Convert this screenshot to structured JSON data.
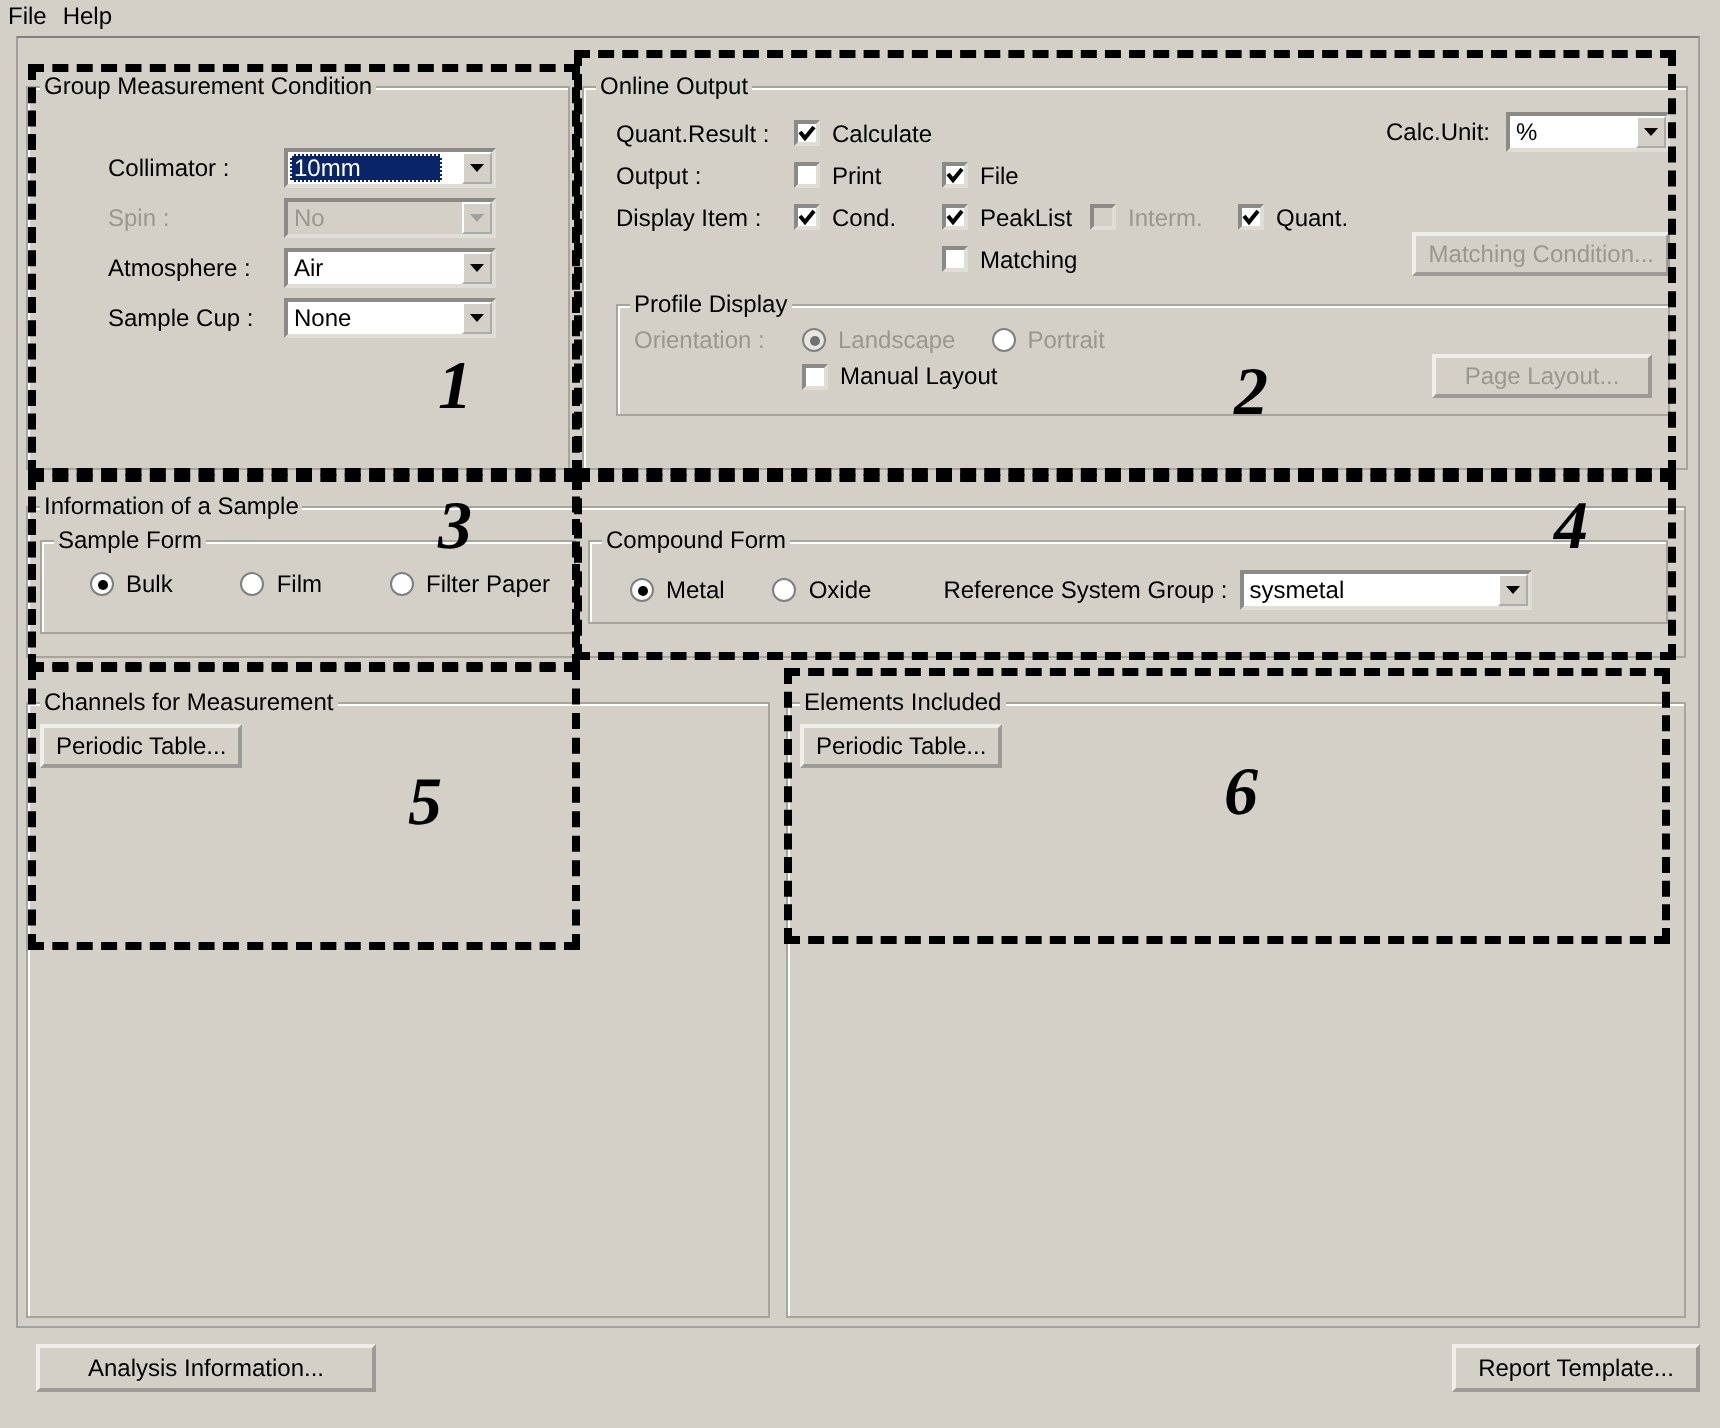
{
  "menu": [
    {
      "label": "File"
    },
    {
      "label": "Help"
    }
  ],
  "group_measurement": {
    "title": "Group Measurement Condition",
    "fields": [
      {
        "label": "Collimator :",
        "value": "10mm",
        "focused": true,
        "disabled": false
      },
      {
        "label": "Spin :",
        "value": "No",
        "focused": false,
        "disabled": true
      },
      {
        "label": "Atmosphere :",
        "value": "Air",
        "focused": false,
        "disabled": false
      },
      {
        "label": "Sample Cup :",
        "value": "None",
        "focused": false,
        "disabled": false
      }
    ]
  },
  "online_output": {
    "title": "Online Output",
    "rows": [
      {
        "label": "Quant.Result :",
        "checkboxes": [
          {
            "label": "Calculate",
            "checked": true,
            "disabled": false
          }
        ]
      },
      {
        "label": "Output :",
        "checkboxes": [
          {
            "label": "Print",
            "checked": false,
            "disabled": false
          },
          {
            "label": "File",
            "checked": true,
            "disabled": false
          }
        ]
      },
      {
        "label": "Display Item :",
        "checkboxes": [
          {
            "label": "Cond.",
            "checked": true,
            "disabled": false
          },
          {
            "label": "PeakList",
            "checked": true,
            "disabled": false
          },
          {
            "label": "Interm.",
            "checked": false,
            "disabled": true
          },
          {
            "label": "Quant.",
            "checked": true,
            "disabled": false
          }
        ]
      },
      {
        "checkboxes": [
          {
            "label": "Matching",
            "checked": false,
            "disabled": false
          }
        ]
      }
    ],
    "calc_unit": {
      "label": "Calc.Unit:",
      "value": "%"
    },
    "matching_button": {
      "label": "Matching Condition...",
      "disabled": true
    },
    "profile_display": {
      "title": "Profile Display",
      "orientation": {
        "label": "Orientation :",
        "disabled": true,
        "options": [
          {
            "label": "Landscape",
            "selected": true
          },
          {
            "label": "Portrait",
            "selected": false
          }
        ]
      },
      "manual_layout": {
        "label": "Manual Layout",
        "checked": false,
        "disabled": false
      },
      "page_layout_button": {
        "label": "Page Layout...",
        "disabled": true
      }
    }
  },
  "sample_info": {
    "title": "Information of a Sample",
    "sample_form": {
      "title": "Sample Form",
      "options": [
        {
          "label": "Bulk",
          "selected": true
        },
        {
          "label": "Film",
          "selected": false
        },
        {
          "label": "Filter Paper",
          "selected": false
        }
      ]
    },
    "compound_form": {
      "title": "Compound Form",
      "options": [
        {
          "label": "Metal",
          "selected": true
        },
        {
          "label": "Oxide",
          "selected": false
        }
      ],
      "reference": {
        "label": "Reference System Group :",
        "value": "sysmetal"
      }
    }
  },
  "channels": {
    "title": "Channels for Measurement",
    "button": "Periodic Table..."
  },
  "elements": {
    "title": "Elements Included",
    "button": "Periodic Table..."
  },
  "footer_buttons": [
    {
      "label": "Analysis Information..."
    },
    {
      "label": "Report Template..."
    }
  ],
  "annotations": [
    {
      "label": "1"
    },
    {
      "label": "2"
    },
    {
      "label": "3"
    },
    {
      "label": "4"
    },
    {
      "label": "5"
    },
    {
      "label": "6"
    }
  ]
}
